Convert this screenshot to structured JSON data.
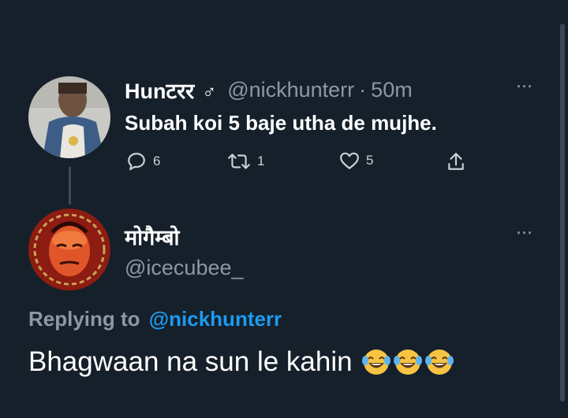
{
  "colors": {
    "background": "#15202b",
    "text": "#ffffff",
    "muted": "#8b98a5",
    "link": "#1d9bf0"
  },
  "parent_tweet": {
    "display_name": "Hunटरर",
    "gender_symbol": "♂",
    "handle": "@nickhunterr",
    "separator": "·",
    "time": "50m",
    "text": "Subah koi 5 baje utha de mujhe.",
    "more_label": "···",
    "actions": {
      "replies": "6",
      "retweets": "1",
      "likes": "5"
    },
    "icons": [
      "reply-icon",
      "retweet-icon",
      "like-icon",
      "share-icon"
    ]
  },
  "reply_tweet": {
    "display_name": "मोगैम्बो",
    "handle": "@icecubee_",
    "more_label": "···",
    "replying_prefix": "Replying to",
    "replying_handle": "@nickhunterr",
    "text": "Bhagwaan na sun le kahin",
    "emojis": [
      "face-with-tears-of-joy",
      "face-with-tears-of-joy",
      "face-with-tears-of-joy"
    ]
  }
}
